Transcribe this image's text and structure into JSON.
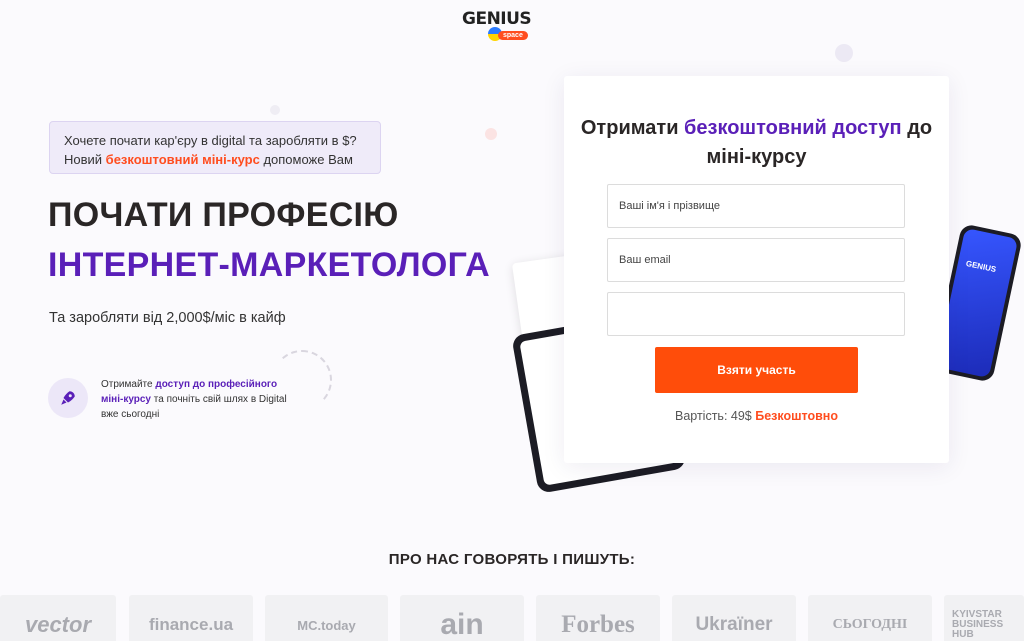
{
  "logo": {
    "text": "GENIUS",
    "badge": "space"
  },
  "intro": {
    "line1": "Хочете почати кар'єру в digital та заробляти в $?",
    "line2_prefix": "Новий ",
    "line2_highlight": "безкоштовний міні-курс",
    "line2_suffix": " допоможе Вам"
  },
  "headline": {
    "line1": "ПОЧАТИ ПРОФЕСІЮ",
    "line2": "ІНТЕРНЕТ-МАРКЕТОЛОГА"
  },
  "subtext": "Та заробляти від 2,000$/міс в кайф",
  "offer": {
    "prefix": "Отримайте ",
    "highlight1": "доступ до професійного міні-курсу",
    "suffix": " та почніть свій шлях в Digital вже сьогодні"
  },
  "form": {
    "title_prefix": "Отримати ",
    "title_highlight": "безкоштовний доступ",
    "title_suffix": " до міні-курсу",
    "name_placeholder": "Ваші ім'я і прізвище",
    "email_placeholder": "Ваш email",
    "phone_placeholder": "",
    "submit_label": "Взяти участь",
    "price_label": "Вартість: ",
    "price_old": "49$",
    "price_free": "Безкоштовно"
  },
  "phone_screen_text": "GENIUS",
  "press": {
    "title": "ПРО НАС ГОВОРЯТЬ І ПИШУТЬ:",
    "logos": [
      "vector",
      "finance.ua",
      "MC.today",
      "ain",
      "Forbes",
      "Ukraïner",
      "СЬОГОДНІ",
      "KYIVSTAR BUSINESS HUB"
    ]
  },
  "colors": {
    "accent_purple": "#5a1fb8",
    "accent_orange": "#ff4d0a",
    "background": "#fbfafd"
  }
}
